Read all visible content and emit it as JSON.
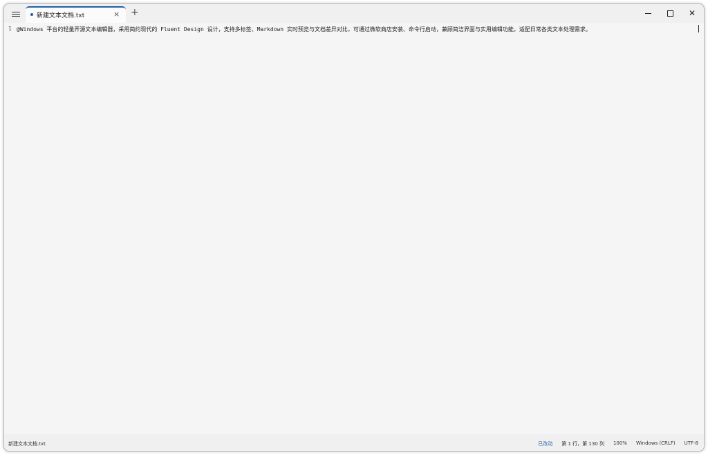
{
  "tab": {
    "title": "新建文本文档.txt",
    "close_glyph": "×",
    "new_tab_glyph": "+"
  },
  "window_controls": {
    "close_glyph": "✕"
  },
  "editor": {
    "line_number": "1",
    "text": "@Windows 平台的轻量开源文本编辑器，采用简约现代的 Fluent Design 设计，支持多标签、Markdown 实时预览与文档差异对比，可通过微软商店安装、命令行启动，兼顾简洁界面与实用编辑功能，适配日常各类文本处理需求。"
  },
  "statusbar": {
    "filename": "新建文本文档.txt",
    "saved": "已改动",
    "position": "第 1 行，第 130 列",
    "zoom": "100%",
    "line_ending": "Windows (CRLF)",
    "encoding": "UTF-8"
  },
  "colors": {
    "accent": "#1f5fa6",
    "editor_bg": "#f5f5f5"
  }
}
